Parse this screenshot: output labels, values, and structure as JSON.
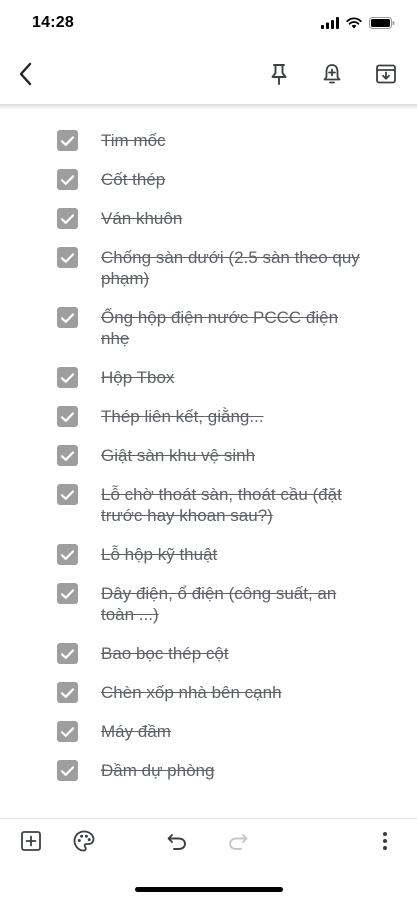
{
  "status_bar": {
    "time": "14:28"
  },
  "toolbar": {
    "back_icon": "chevron-left-icon",
    "pin_icon": "pin-icon",
    "reminder_icon": "bell-add-icon",
    "archive_icon": "archive-icon"
  },
  "checklist": {
    "items": [
      {
        "label": "Tim mốc",
        "checked": true
      },
      {
        "label": "Cốt thép",
        "checked": true
      },
      {
        "label": "Ván khuôn",
        "checked": true
      },
      {
        "label": "Chống sàn dưới (2.5 sàn theo quy phạm)",
        "checked": true
      },
      {
        "label": "Ống hộp điện nước PCCC điện nhẹ",
        "checked": true
      },
      {
        "label": "Hộp Tbox",
        "checked": true
      },
      {
        "label": "Thép liên kết, giằng...",
        "checked": true
      },
      {
        "label": "Giật sàn khu vệ sinh",
        "checked": true
      },
      {
        "label": "Lỗ chờ thoát sàn, thoát cầu (đặt trước hay khoan sau?)",
        "checked": true
      },
      {
        "label": "Lỗ hộp kỹ thuật",
        "checked": true
      },
      {
        "label": "Dây điện, ổ điện (công suất, an toàn ...)",
        "checked": true
      },
      {
        "label": "Bao bọc thép cột",
        "checked": true
      },
      {
        "label": "Chèn xốp nhà bên cạnh",
        "checked": true
      },
      {
        "label": "Máy đầm",
        "checked": true
      },
      {
        "label": "Đầm dự phòng",
        "checked": true
      }
    ]
  },
  "bottom_bar": {
    "add_icon": "add-box-icon",
    "palette_icon": "palette-icon",
    "undo_icon": "undo-icon",
    "redo_icon": "redo-icon",
    "more_icon": "more-vert-icon"
  },
  "colors": {
    "checkbox": "#9e9e9e",
    "text": "#5f6368",
    "icon": "#3c4043"
  }
}
